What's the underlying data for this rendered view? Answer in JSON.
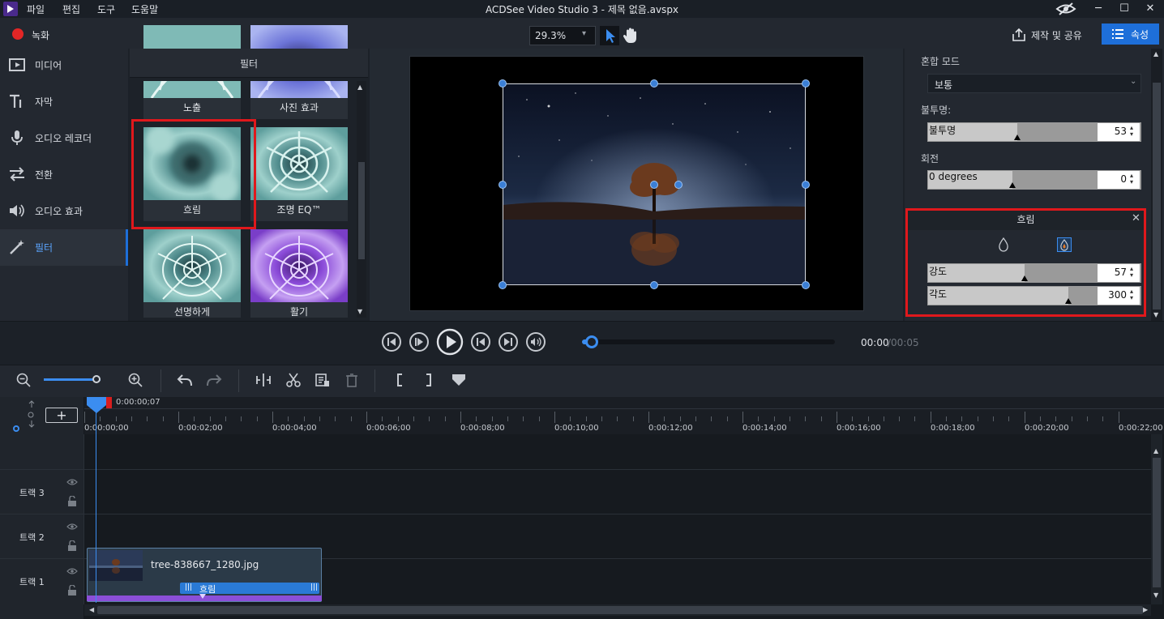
{
  "titlebar": {
    "title": "ACDSee Video Studio 3 - 제목 없음.avspx",
    "menu": [
      "파일",
      "편집",
      "도구",
      "도움말"
    ],
    "buttons": {
      "minimize": "─",
      "maximize": "☐",
      "close": "✕"
    }
  },
  "toolbar": {
    "record_label": "녹화",
    "zoom_value": "29.3%",
    "share_label": "제작 및 공유",
    "properties_label": "속성",
    "accent_color": "#1e6fd9",
    "record_color": "#e32626"
  },
  "nav": {
    "items": [
      {
        "label": "미디어",
        "icon": "film-icon"
      },
      {
        "label": "자막",
        "icon": "text-icon"
      },
      {
        "label": "오디오 레코더",
        "icon": "microphone-icon"
      },
      {
        "label": "전환",
        "icon": "transition-icon"
      },
      {
        "label": "오디오 효과",
        "icon": "speaker-icon"
      },
      {
        "label": "필터",
        "icon": "magic-wand-icon"
      }
    ],
    "active_index": 5
  },
  "filters": {
    "title": "필터",
    "items": [
      {
        "label": "노출"
      },
      {
        "label": "사진 효과"
      },
      {
        "label": "흐림"
      },
      {
        "label": "조명 EQ™"
      },
      {
        "label": "선명하게"
      },
      {
        "label": "활기"
      }
    ],
    "selected_index": 2
  },
  "properties": {
    "blend_mode_label": "혼합 모드",
    "blend_mode_value": "보통",
    "opacity_label": "불투명:",
    "opacity_slider_label": "불투명",
    "opacity_value": "53",
    "opacity_fraction": 0.53,
    "rotation_label": "회전",
    "rotation_slider_label": "0 degrees",
    "rotation_value": "0",
    "rotation_fraction": 0.5,
    "blur": {
      "title": "흐림",
      "strength_label": "강도",
      "strength_value": "57",
      "strength_fraction": 0.57,
      "angle_label": "각도",
      "angle_value": "300",
      "angle_fraction": 0.83
    }
  },
  "transport": {
    "time_current": "00:00",
    "time_total": "/00:05"
  },
  "timeline": {
    "playhead_time": "0:00:00;07",
    "ticks": [
      "0:00:00;00",
      "0:00:02;00",
      "0:00:04;00",
      "0:00:06;00",
      "0:00:08;00",
      "0:00:10;00",
      "0:00:12;00",
      "0:00:14;00",
      "0:00:16;00",
      "0:00:18;00",
      "0:00:20;00",
      "0:00:22;00"
    ],
    "tracks": [
      {
        "label": "트랙 3"
      },
      {
        "label": "트랙 2"
      },
      {
        "label": "트랙 1"
      }
    ],
    "clip": {
      "filename": "tree-838667_1280.jpg",
      "filter_label": "흐림"
    },
    "add_label": "+"
  }
}
